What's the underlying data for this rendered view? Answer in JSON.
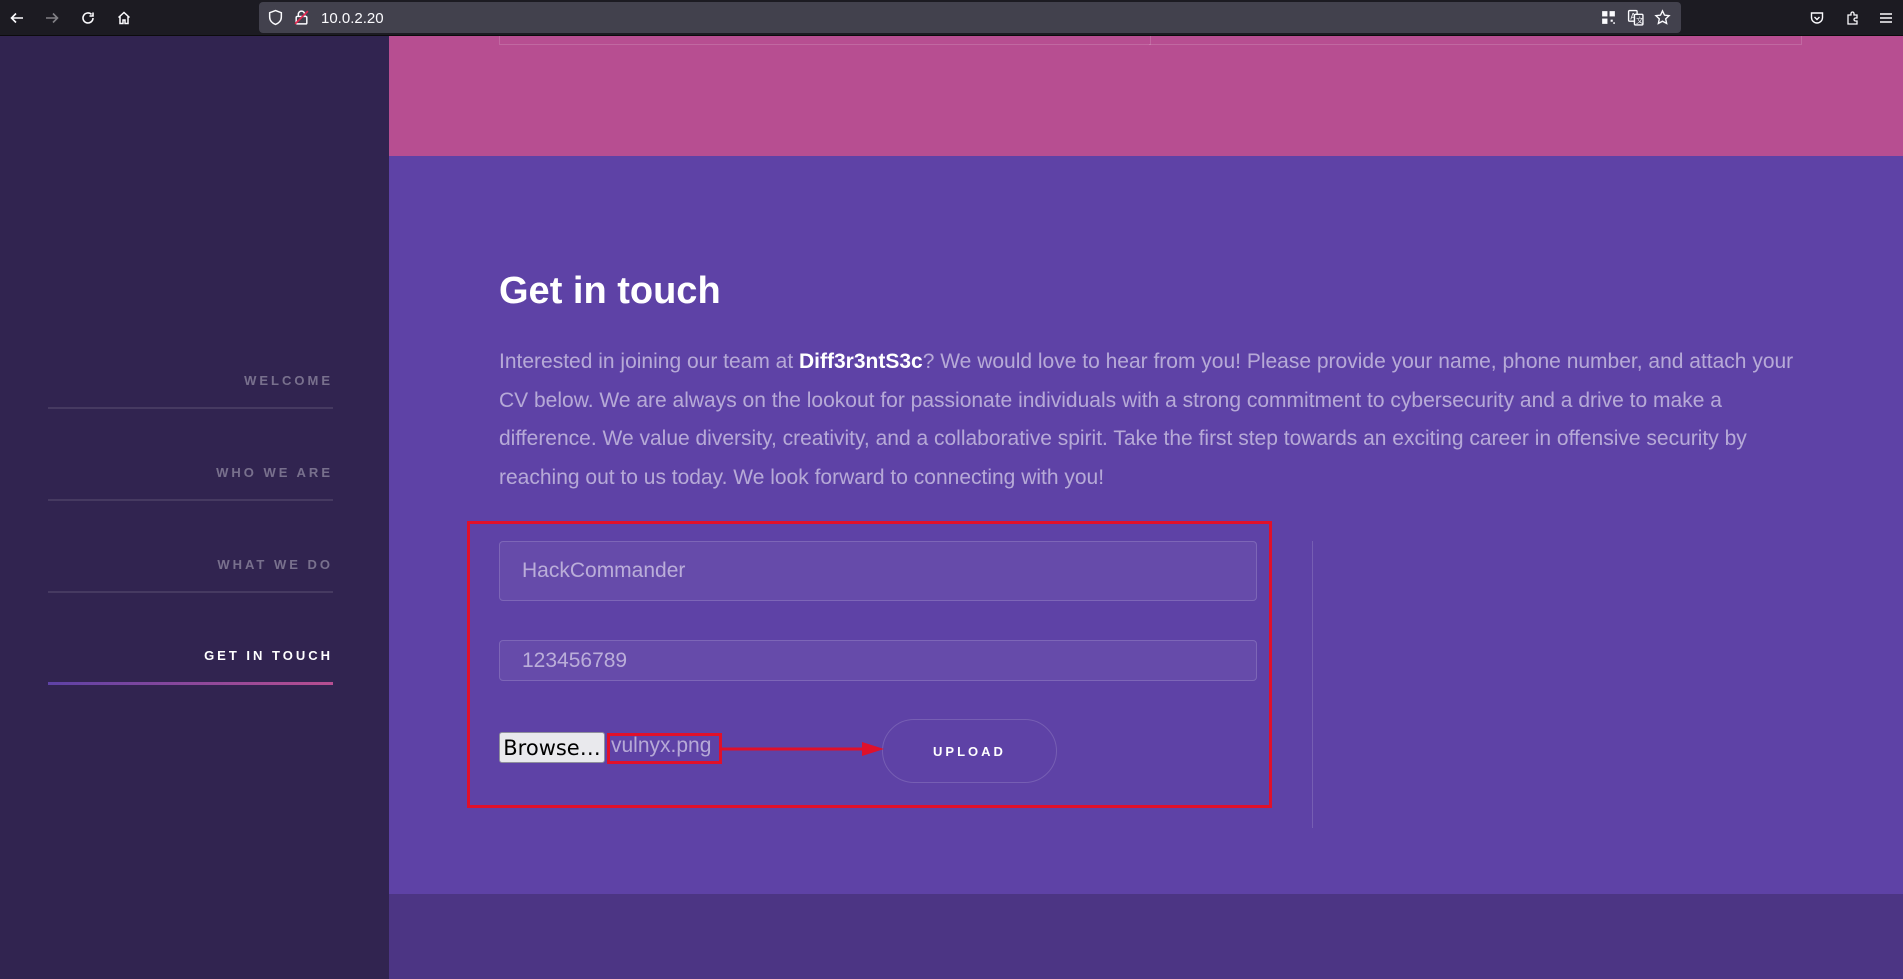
{
  "browser": {
    "url": "10.0.2.20",
    "icons": [
      "back-arrow-icon",
      "forward-arrow-icon",
      "reload-icon",
      "home-icon",
      "shield-icon",
      "insecure-lock-icon",
      "qr-code-icon",
      "translate-icon",
      "star-icon",
      "pocket-icon",
      "extensions-icon",
      "menu-icon"
    ]
  },
  "sidebar": {
    "items": [
      {
        "label": "WELCOME",
        "active": false
      },
      {
        "label": "WHO WE ARE",
        "active": false
      },
      {
        "label": "WHAT WE DO",
        "active": false
      },
      {
        "label": "GET IN TOUCH",
        "active": true
      }
    ]
  },
  "section": {
    "title": "Get in touch",
    "intro_before": "Interested in joining our team at ",
    "company": "Diff3r3ntS3c",
    "intro_after": "? We would love to hear from you! Please provide your name, phone number, and attach your CV below. We are always on the lookout for passionate individuals with a strong commitment to cybersecurity and a drive to make a difference. We value diversity, creativity, and a collaborative spirit. Take the first step towards an exciting career in offensive security by reaching out to us today. We look forward to connecting with you!"
  },
  "form": {
    "name_value": "HackCommander",
    "phone_value": "123456789",
    "browse_label": "Browse…",
    "file_name": "vulnyx.png",
    "upload_label": "UPLOAD"
  },
  "colors": {
    "sidebar_bg": "#312450",
    "accent_pink": "#b74e91",
    "section_purple": "#5e42a6",
    "annotation_red": "#e0102a"
  }
}
